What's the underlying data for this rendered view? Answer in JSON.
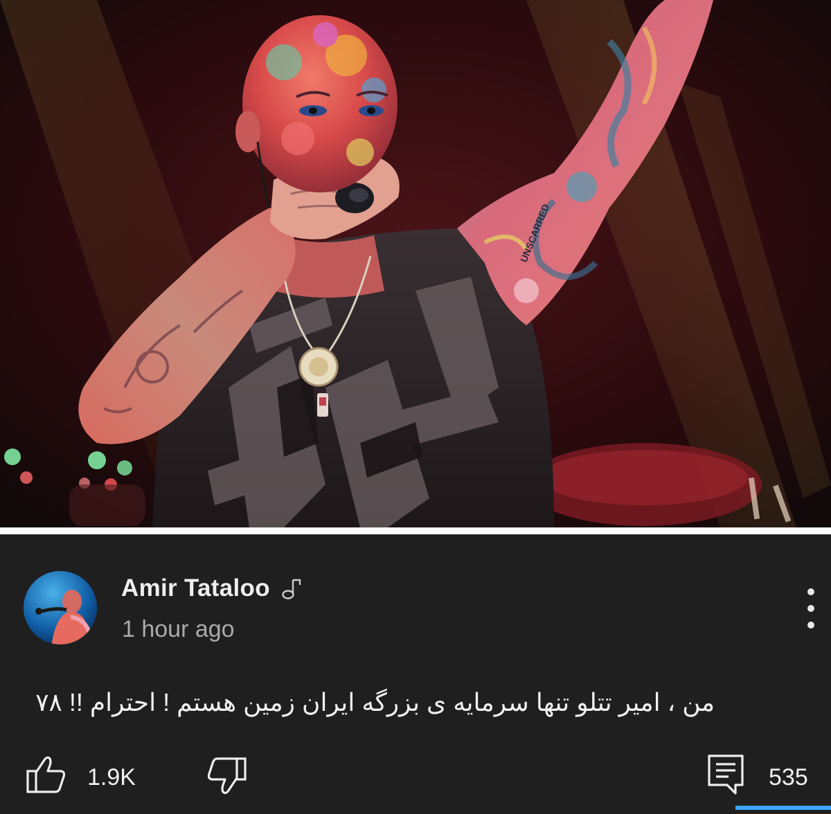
{
  "colors": {
    "panel_background": "#1f1f1f",
    "primary_text": "#f1f1f1",
    "secondary_text": "#aaaaaa",
    "accent": "#3ea6ff"
  },
  "photo": {
    "tattoo_text": "UNSCARRED"
  },
  "post": {
    "author": {
      "name": "Amir Tataloo",
      "badge_icon": "music-note-icon",
      "avatar_icon": "avatar-image"
    },
    "timestamp": "1 hour ago",
    "menu_icon": "more-vert-icon",
    "text": "من ، امیر تتلو تنها سرمایه ی بزرگه ایران زمین هستم ! احترام !! ۷۸",
    "actions": {
      "like_icon": "thumbs-up-icon",
      "like_count": "1.9K",
      "dislike_icon": "thumbs-down-icon",
      "comment_icon": "comment-icon",
      "comment_count": "535"
    }
  }
}
